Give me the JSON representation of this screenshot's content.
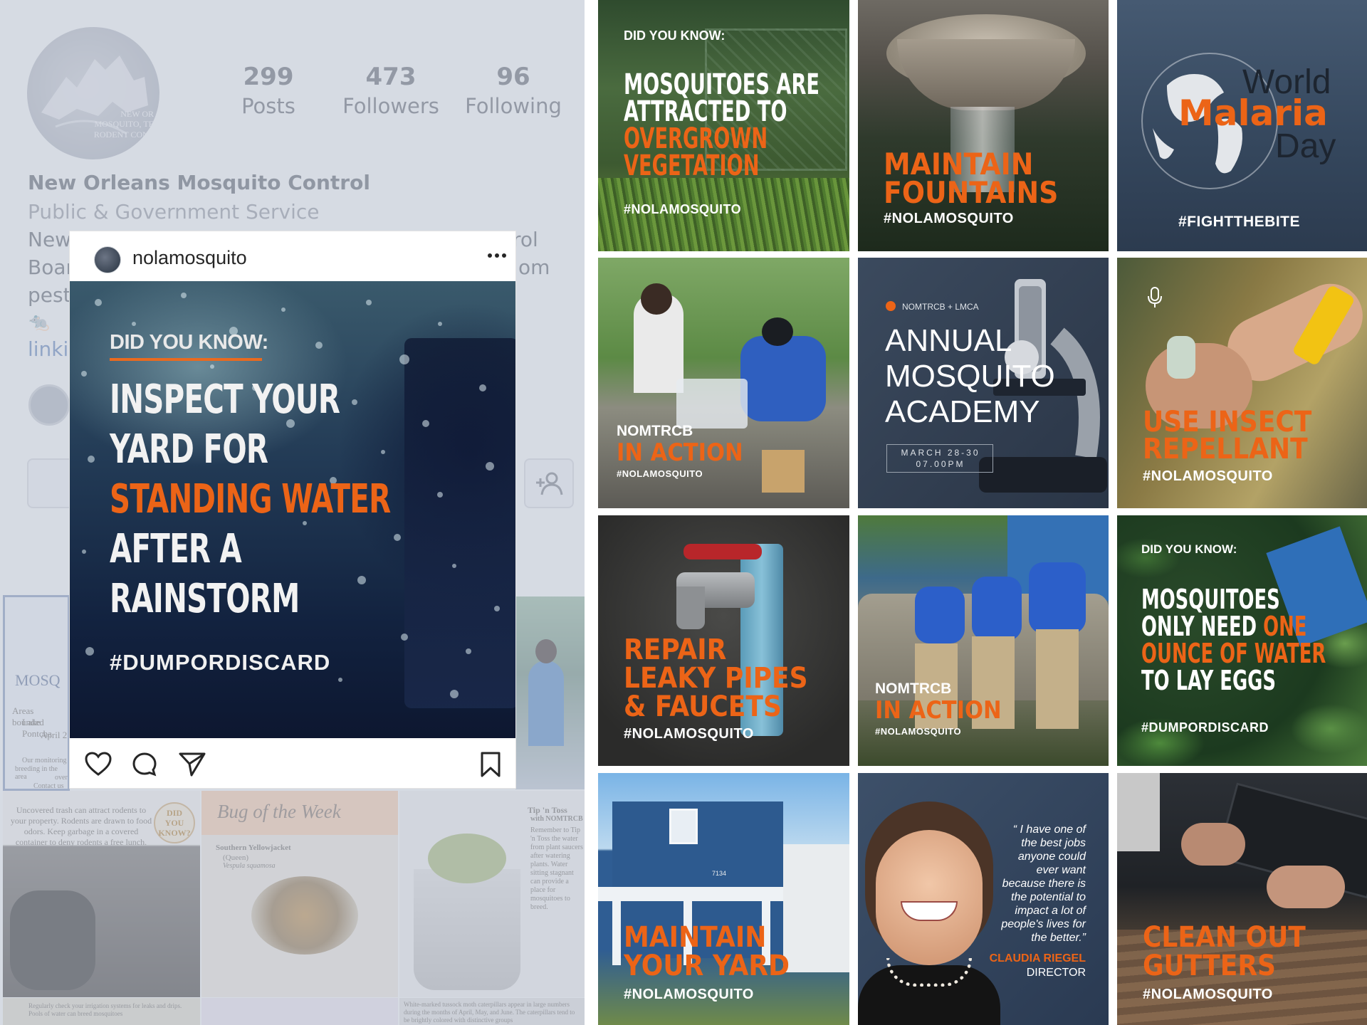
{
  "profile": {
    "avatar_text": [
      "NEW OR",
      "MOSQUITO, TE",
      "RODENT CONT"
    ],
    "stats": [
      {
        "num": "299",
        "label": "Posts"
      },
      {
        "num": "473",
        "label": "Followers"
      },
      {
        "num": "96",
        "label": "Following"
      }
    ],
    "name": "New Orleans Mosquito Control",
    "category": "Public & Government Service",
    "bio_lines": [
      "New",
      "Boar",
      "pest"
    ],
    "bio_right": [
      "rol",
      "om"
    ],
    "link": "linki",
    "grid_texts": {
      "mosq": "MOSQ",
      "areas": "Areas bounded",
      "lake": "Lake Pontcha",
      "april": "April 2",
      "monitoring": "Our monitoring",
      "breeding": "breeding in the area",
      "over": "over",
      "contact": "Contact us",
      "uncovered": "Uncovered trash can attract rodents to your property. Rodents are drawn to food odors. Keep garbage in a covered container to deny rodents a free lunch.",
      "did_you_know": "DID YOU KNOW?",
      "bug": "Bug of the Week",
      "yellowjacket": "Southern Yellowjacket",
      "queen": "(Queen)",
      "species": "Vespula squamosa",
      "tip": "Tip 'n Toss",
      "with": "with NOMTRCB",
      "remember": "Remember to Tip 'n Toss the water from plant saucers after watering plants. Water sitting stagnant can provide a place for mosquitoes to breed.",
      "regularly": "Regularly check your irrigation systems for leaks and drips. Pools of water can breed mosquitoes",
      "tussock": "White-marked tussock moth caterpillars appear in large numbers during the months of April, May, and June. The caterpillars tend to be brightly colored with distinctive groups"
    }
  },
  "post": {
    "username": "nolamosquito",
    "did_you_know": "DID YOU KNOW:",
    "lines": [
      {
        "text": "INSPECT YOUR",
        "color": "#f2f2f2"
      },
      {
        "text": "YARD FOR",
        "color": "#f2f2f2"
      },
      {
        "text": "STANDING WATER",
        "color": "#ec6417"
      },
      {
        "text": "AFTER A",
        "color": "#f2f2f2"
      },
      {
        "text": "RAINSTORM",
        "color": "#f2f2f2"
      }
    ],
    "hashtag": "#DUMPORDISCARD"
  },
  "grid": {
    "t1": {
      "dyk": "DID YOU KNOW:",
      "l1": "MOSQUITOES ARE",
      "l2": "ATTRACTED TO",
      "l3": "OVERGROWN",
      "l4": "VEGETATION",
      "tag": "#NOLAMOSQUITO"
    },
    "t2": {
      "l1": "MAINTAIN",
      "l2": "FOUNTAINS",
      "tag": "#NOLAMOSQUITO"
    },
    "t3": {
      "l1": "World",
      "l2": "Malaria",
      "l3": "Day",
      "tag": "#FIGHTTHEBITE"
    },
    "t4": {
      "l1": "NOMTRCB",
      "l2": "IN ACTION",
      "tag": "#NOLAMOSQUITO"
    },
    "t5": {
      "org": "NOMTRCB + LMCA",
      "l1": "ANNUAL",
      "l2": "MOSQUITO",
      "l3": "ACADEMY",
      "date": "MARCH 28-30",
      "time": "07.00PM"
    },
    "t6": {
      "l1": "USE INSECT",
      "l2": "REPELLANT",
      "tag": "#NOLAMOSQUITO"
    },
    "t7": {
      "l1": "REPAIR",
      "l2": "LEAKY PIPES",
      "l3": "& FAUCETS",
      "tag": "#NOLAMOSQUITO"
    },
    "t8": {
      "l1": "NOMTRCB",
      "l2": "IN ACTION",
      "tag": "#NOLAMOSQUITO"
    },
    "t9": {
      "dyk": "DID YOU KNOW:",
      "l1": "MOSQUITOES",
      "l2a": "ONLY NEED ",
      "l2b": "ONE",
      "l3": "OUNCE OF WATER",
      "l4": "TO LAY EGGS",
      "tag": "#DUMPORDISCARD"
    },
    "t10": {
      "house": "7134",
      "l1": "MAINTAIN",
      "l2": "YOUR YARD",
      "tag": "#NOLAMOSQUITO"
    },
    "t11": {
      "quote": [
        "“ I have one of",
        "the best jobs",
        "anyone could",
        "ever want",
        "because there is",
        "the potential to",
        "impact a lot of",
        "people's lives for",
        "the better.”"
      ],
      "name": "CLAUDIA RIEGEL",
      "role": "DIRECTOR"
    },
    "t12": {
      "l1": "CLEAN OUT",
      "l2": "GUTTERS",
      "tag": "#NOLAMOSQUITO"
    }
  }
}
